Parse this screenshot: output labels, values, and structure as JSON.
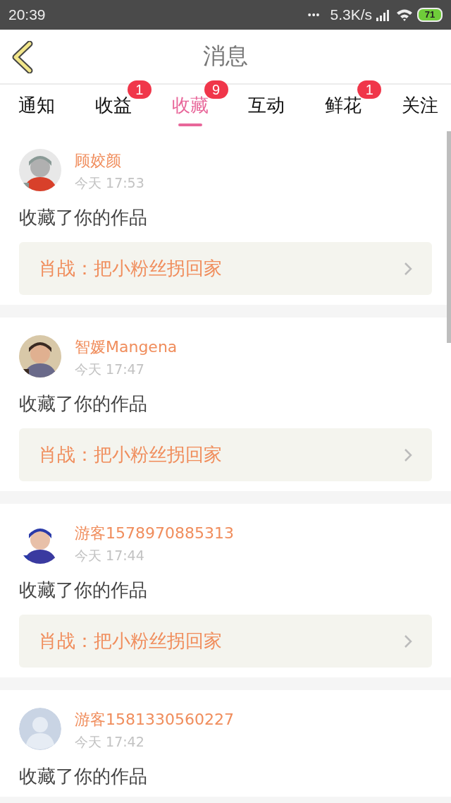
{
  "status_bar": {
    "time": "20:39",
    "dots": "•••",
    "speed": "5.3K/s",
    "battery": "71"
  },
  "header": {
    "title": "消息"
  },
  "tabs": [
    {
      "label": "通知",
      "selected": false
    },
    {
      "label": "收益",
      "selected": false,
      "badge": "1"
    },
    {
      "label": "收藏",
      "selected": true,
      "badge": "9"
    },
    {
      "label": "互动",
      "selected": false
    },
    {
      "label": "鲜花",
      "selected": false,
      "badge": "1"
    },
    {
      "label": "关注",
      "selected": false
    }
  ],
  "messages": [
    {
      "kind": "picture",
      "user": "顾姣颜",
      "time": "今天 17:53",
      "text": "收藏了你的作品",
      "work": "肖战：把小粉丝拐回家"
    },
    {
      "kind": "picture",
      "user": "智媛Mangena",
      "time": "今天 17:47",
      "text": "收藏了你的作品",
      "work": "肖战：把小粉丝拐回家"
    },
    {
      "kind": "picture",
      "user": "游客1578970885313",
      "time": "今天 17:44",
      "text": "收藏了你的作品",
      "work": "肖战：把小粉丝拐回家"
    },
    {
      "kind": "avatar",
      "user": "游客1581330560227",
      "time": "今天 17:42",
      "text": "收藏了你的作品"
    }
  ]
}
